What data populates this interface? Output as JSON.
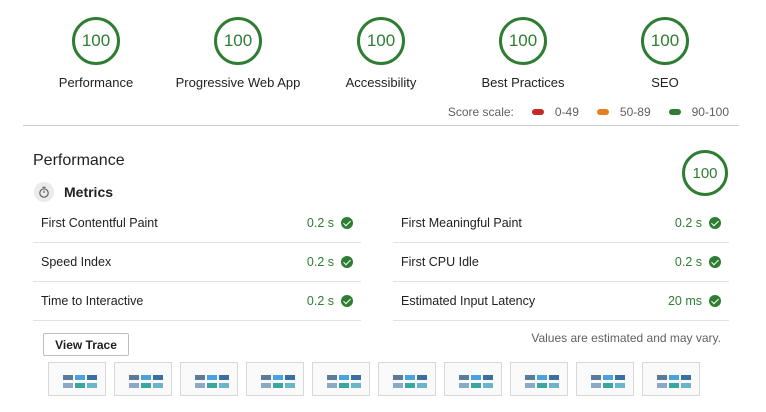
{
  "gauges": [
    {
      "score": "100",
      "label": "Performance"
    },
    {
      "score": "100",
      "label": "Progressive Web App"
    },
    {
      "score": "100",
      "label": "Accessibility"
    },
    {
      "score": "100",
      "label": "Best Practices"
    },
    {
      "score": "100",
      "label": "SEO"
    }
  ],
  "score_scale": {
    "label": "Score scale:",
    "ranges": [
      {
        "text": "0-49",
        "color": "#c62828"
      },
      {
        "text": "50-89",
        "color": "#e67e22"
      },
      {
        "text": "90-100",
        "color": "#2e7d32"
      }
    ]
  },
  "performance": {
    "title": "Performance",
    "score": "100",
    "metrics_title": "Metrics",
    "metrics_left": [
      {
        "name": "First Contentful Paint",
        "value": "0.2 s"
      },
      {
        "name": "Speed Index",
        "value": "0.2 s"
      },
      {
        "name": "Time to Interactive",
        "value": "0.2 s"
      }
    ],
    "metrics_right": [
      {
        "name": "First Meaningful Paint",
        "value": "0.2 s"
      },
      {
        "name": "First CPU Idle",
        "value": "0.2 s"
      },
      {
        "name": "Estimated Input Latency",
        "value": "20 ms"
      }
    ],
    "view_trace_label": "View Trace",
    "estimate_note": "Values are estimated and may vary."
  },
  "colors": {
    "pass": "#2e7d32",
    "average": "#e67e22",
    "fail": "#c62828"
  }
}
